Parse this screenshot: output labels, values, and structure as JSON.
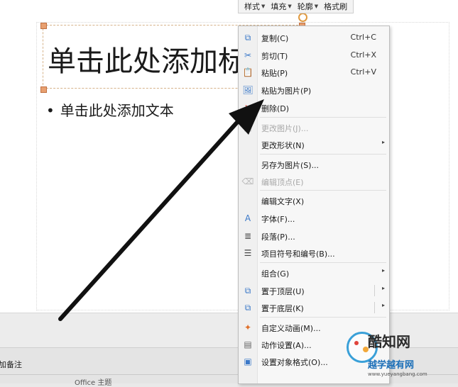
{
  "slide": {
    "title_placeholder": "单击此处添加标题",
    "body_placeholder": "单击此处添加文本",
    "bullet": "•"
  },
  "mini_toolbar": {
    "items": [
      {
        "label": "样式",
        "arrow": "▼"
      },
      {
        "label": "填充",
        "arrow": "▼"
      },
      {
        "label": "轮廓",
        "arrow": "▼"
      },
      {
        "label": "格式刷",
        "arrow": ""
      }
    ]
  },
  "context_menu": {
    "items": [
      {
        "label": "复制(C)",
        "shortcut": "Ctrl+C",
        "icon": "copy-icon",
        "glyph": "⧉",
        "color": "#3a78c8"
      },
      {
        "label": "剪切(T)",
        "shortcut": "Ctrl+X",
        "icon": "cut-icon",
        "glyph": "✂",
        "color": "#3a78c8"
      },
      {
        "label": "粘贴(P)",
        "shortcut": "Ctrl+V",
        "icon": "paste-icon",
        "glyph": "📋",
        "color": "#3a78c8"
      },
      {
        "label": "粘贴为图片(P)",
        "icon": "paste-as-picture-icon",
        "glyph": "🖼",
        "color": "#3a78c8"
      },
      {
        "label": "删除(D)",
        "icon": "delete-icon",
        "glyph": "✕",
        "color": "#d93a2b"
      },
      {
        "label": "更改图片(J)...",
        "icon": "change-picture-icon",
        "glyph": "▣",
        "color": "#b8b8b8"
      },
      {
        "label": "更改形状(N)",
        "icon": "",
        "glyph": "",
        "submenu": "▸"
      },
      {
        "label": "另存为图片(S)...",
        "icon": "",
        "glyph": ""
      },
      {
        "label": "编辑顶点(E)",
        "icon": "edit-points-icon",
        "glyph": "⌫",
        "color": "#b8b8b8"
      },
      {
        "label": "编辑文字(X)",
        "icon": "",
        "glyph": ""
      },
      {
        "label": "字体(F)...",
        "icon": "font-icon",
        "glyph": "A",
        "color": "#3a78c8"
      },
      {
        "label": "段落(P)...",
        "icon": "paragraph-icon",
        "glyph": "≣",
        "color": "#444444"
      },
      {
        "label": "项目符号和编号(B)...",
        "icon": "bullets-icon",
        "glyph": "☰",
        "color": "#444444"
      },
      {
        "label": "组合(G)",
        "icon": "",
        "glyph": "",
        "submenu": "▸"
      },
      {
        "label": "置于顶层(U)",
        "icon": "bring-to-front-icon",
        "glyph": "⧉",
        "color": "#3a78c8",
        "submenu": "▸"
      },
      {
        "label": "置于底层(K)",
        "icon": "send-to-back-icon",
        "glyph": "⧉",
        "color": "#3a78c8",
        "submenu": "▸"
      },
      {
        "label": "自定义动画(M)...",
        "icon": "custom-animation-icon",
        "glyph": "✦",
        "color": "#e0702a"
      },
      {
        "label": "动作设置(A)...",
        "icon": "action-settings-icon",
        "glyph": "▤",
        "color": "#666666"
      },
      {
        "label": "设置对象格式(O)...",
        "icon": "format-object-icon",
        "glyph": "▣",
        "color": "#3a78c8"
      }
    ]
  },
  "statusbar": {
    "notes": "加备注",
    "theme": "Office 主题"
  },
  "watermark": {
    "name": "酷知网",
    "sub": "越学越有网",
    "url": "www.yueyangbang.com"
  }
}
